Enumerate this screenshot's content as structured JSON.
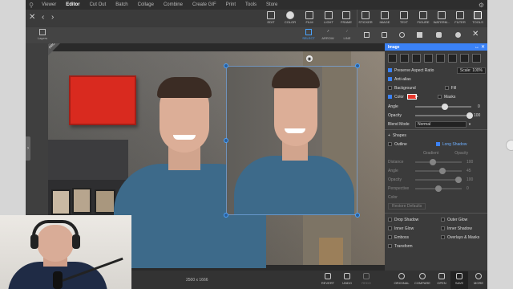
{
  "menu": {
    "items": [
      "Viewer",
      "Editor",
      "Cut Out",
      "Batch",
      "Collage",
      "Combine",
      "Create GIF",
      "Print",
      "Tools",
      "Store"
    ],
    "active": "Editor"
  },
  "toolbar": {
    "tools": [
      {
        "label": "EDIT",
        "icon": "edit-icon"
      },
      {
        "label": "COLOR",
        "icon": "color-icon"
      },
      {
        "label": "FILM",
        "icon": "film-icon"
      },
      {
        "label": "LIGHT",
        "icon": "light-icon"
      },
      {
        "label": "FRAME",
        "icon": "frame-icon"
      },
      {
        "label": "STICKER",
        "icon": "sticker-icon"
      },
      {
        "label": "IMAGE",
        "icon": "image-icon"
      },
      {
        "label": "TEXT",
        "icon": "text-icon"
      },
      {
        "label": "FIGURE",
        "icon": "figure-icon"
      },
      {
        "label": "WATERM...",
        "icon": "watermark-icon"
      },
      {
        "label": "FILTER",
        "icon": "filter-icon"
      },
      {
        "label": "TOOLS",
        "icon": "tools-icon"
      }
    ],
    "selected_label": "TOOLS"
  },
  "subbar": {
    "layers_label": "Layers",
    "select_label": "SELECT",
    "arrow_label": "ARROW",
    "line_label": "LINE"
  },
  "canvas": {
    "badge": "PRO",
    "dimensions": "2500 x 1666"
  },
  "panel": {
    "title": "Image",
    "preserve_aspect_label": "Preserve Aspect Ratio",
    "preserve_aspect_checked": true,
    "scale_label": "Scale: 100%",
    "antialias_label": "Anti-alias",
    "antialias_checked": true,
    "background_label": "Background",
    "background_checked": false,
    "fill_label": "Fill",
    "fill_checked": false,
    "color_label": "Color",
    "color_checked": true,
    "color_value": "#e8362b",
    "masks_label": "Masks",
    "masks_checked": false,
    "angle_label": "Angle",
    "angle_value": "0",
    "opacity_label": "Opacity",
    "opacity_value": "100",
    "blend_label": "Blend Mode",
    "blend_value": "Normal",
    "shapes_label": "Shapes",
    "outline_label": "Outline",
    "long_shadow_label": "Long Shadow",
    "gradient_label": "Gradient",
    "opacity_small_label": "Opacity",
    "distance_label": "Distance",
    "distance_value": "100",
    "angle2_label": "Angle",
    "angle2_value": "45",
    "opacity2_label": "Opacity",
    "opacity2_value": "100",
    "perspective_label": "Perspective",
    "perspective_value": "0",
    "color2_label": "Color",
    "restore_label": "Restore Defaults",
    "effects": [
      {
        "left": "Drop Shadow",
        "right": "Outer Glow"
      },
      {
        "left": "Inner Glow",
        "right": "Inner Shadow"
      },
      {
        "left": "Emboss",
        "right": "Overlays & Masks"
      },
      {
        "left": "Transform",
        "right": ""
      }
    ]
  },
  "bottombar": {
    "buttons": [
      {
        "label": "REVERT",
        "icon": "revert-icon",
        "enabled": true
      },
      {
        "label": "UNDO",
        "icon": "undo-icon",
        "enabled": true
      },
      {
        "label": "REDO",
        "icon": "redo-icon",
        "enabled": false
      },
      {
        "label": "ORIGINAL",
        "icon": "original-icon",
        "enabled": true
      },
      {
        "label": "COMPARE",
        "icon": "compare-icon",
        "enabled": true
      },
      {
        "label": "OPEN",
        "icon": "open-icon",
        "enabled": true
      },
      {
        "label": "SAVE",
        "icon": "save-icon",
        "enabled": true
      },
      {
        "label": "MORE",
        "icon": "more-icon",
        "enabled": true
      }
    ]
  },
  "colors": {
    "accent": "#3b82f6",
    "red_rect": "#d92a1f",
    "shirt": "#3d6a8a"
  }
}
